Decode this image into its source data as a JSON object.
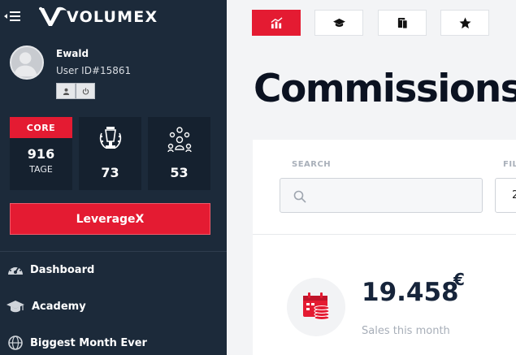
{
  "brand": {
    "name": "VOLUMEX"
  },
  "user": {
    "name": "Ewald",
    "id": "User ID#15861"
  },
  "stats": {
    "core": {
      "tag": "CORE",
      "value": "916",
      "unit": "TAGE"
    },
    "awards": {
      "value": "73"
    },
    "network": {
      "value": "53"
    }
  },
  "leverage_button": "LeverageX",
  "nav": {
    "items": [
      {
        "label": "Dashboard",
        "icon": "dashboard-icon"
      },
      {
        "label": "Academy",
        "icon": "graduation-cap-icon"
      },
      {
        "label": "Biggest Month Ever",
        "icon": "globe-icon"
      }
    ]
  },
  "toolbar": {
    "buttons": [
      {
        "icon": "chart-icon",
        "active": true
      },
      {
        "icon": "graduation-cap-icon",
        "active": false
      },
      {
        "icon": "device-icon",
        "active": false
      },
      {
        "icon": "star-icon",
        "active": false
      }
    ]
  },
  "page": {
    "title": "Commissions"
  },
  "filters": {
    "search_label": "SEARCH",
    "search_placeholder": "",
    "filter_label": "FIL",
    "filter_value": "2"
  },
  "summary": {
    "value": "19.458",
    "currency": "€",
    "label": "Sales this month"
  },
  "colors": {
    "sidebar": "#1c2a3a",
    "accent": "#e41b32",
    "card": "#15212f"
  }
}
